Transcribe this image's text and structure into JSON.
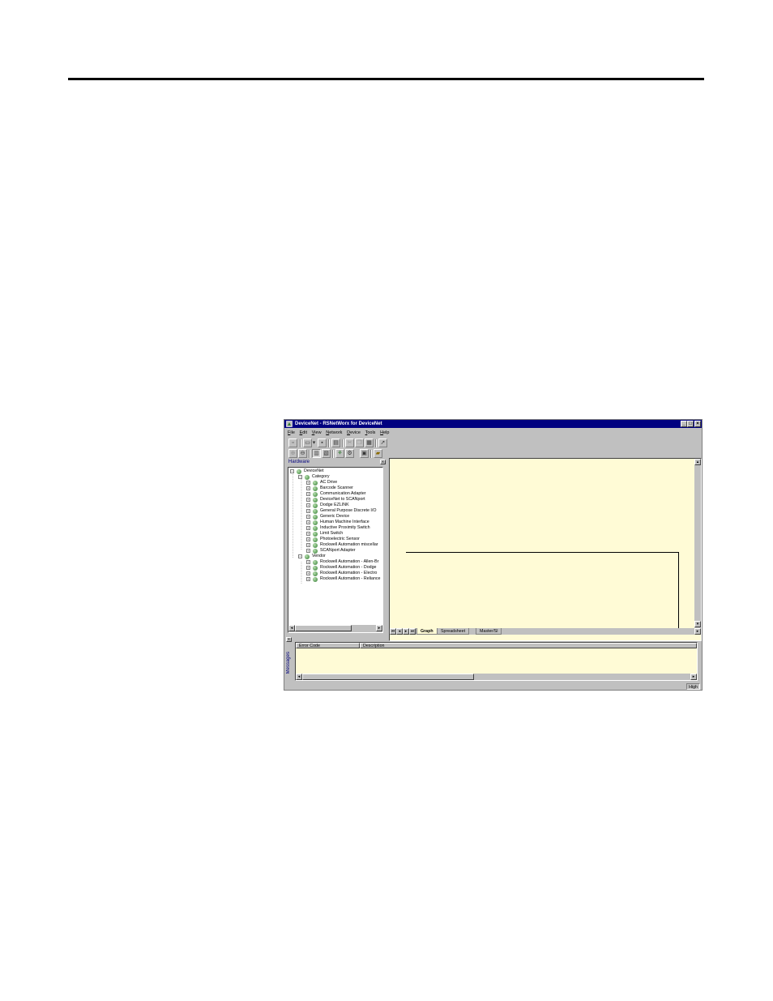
{
  "window": {
    "title": "DeviceNet - RSNetWorx for DeviceNet",
    "controls": {
      "minimize": "_",
      "maximize": "□",
      "close": "×"
    }
  },
  "menu": [
    "File",
    "Edit",
    "View",
    "Network",
    "Device",
    "Tools",
    "Help"
  ],
  "toolbar1": [
    {
      "icon": "new-file-icon",
      "glyph": "▫"
    },
    {
      "icon": "open-folder-icon",
      "glyph": "▭"
    },
    {
      "icon": "dropdown-arrow-icon",
      "glyph": "▾"
    },
    {
      "icon": "save-disk-icon",
      "glyph": "▪"
    },
    {
      "icon": "print-icon",
      "glyph": "▤"
    },
    {
      "icon": "cut-icon",
      "glyph": "✂"
    },
    {
      "icon": "copy-icon",
      "glyph": "❐"
    },
    {
      "icon": "paste-icon",
      "glyph": "▦"
    },
    {
      "icon": "pointer-icon",
      "glyph": "➚"
    }
  ],
  "toolbar2": [
    {
      "icon": "zoom-in-icon",
      "glyph": "⊕"
    },
    {
      "icon": "zoom-out-icon",
      "glyph": "⊖"
    },
    {
      "icon": "hardware-view-icon",
      "glyph": "▥"
    },
    {
      "icon": "tree-view-icon",
      "glyph": "▧"
    },
    {
      "icon": "online-icon",
      "glyph": "⚘"
    },
    {
      "icon": "browse-network-icon",
      "glyph": "⚙"
    },
    {
      "icon": "properties-icon",
      "glyph": "▣"
    },
    {
      "icon": "upload-icon",
      "glyph": "▰"
    }
  ],
  "hardware": {
    "label": "Hardware",
    "root": "DeviceNet",
    "category": {
      "label": "Category",
      "items": [
        "AC Drive",
        "Barcode Scanner",
        "Communication Adapter",
        "DeviceNet to SCANport",
        "Dodge EZLINK",
        "General Purpose Discrete I/O",
        "Generic Device",
        "Human Machine Interface",
        "Inductive Proximity Switch",
        "Limit Switch",
        "Photoelectric Sensor",
        "Rockwell Automation miscellar",
        "SCANport Adapter"
      ]
    },
    "vendor": {
      "label": "Vendor",
      "items": [
        "Rockwell Automation - Allen-Br",
        "Rockwell Automation - Dodge",
        "Rockwell Automation - Electro",
        "Rockwell Automation - Reliance"
      ]
    }
  },
  "graph_tabs": [
    "Graph",
    "Spreadsheet",
    "Master/Sl"
  ],
  "messages": {
    "label": "Messages",
    "columns": [
      "Error Code",
      "Description"
    ]
  },
  "status": {
    "mode": "High"
  }
}
